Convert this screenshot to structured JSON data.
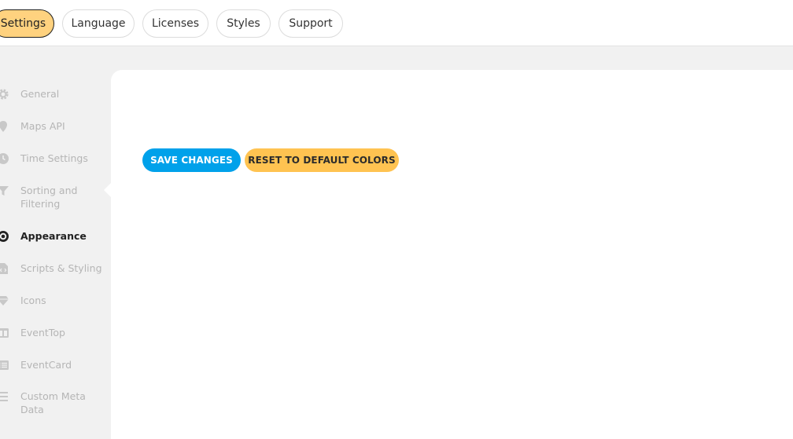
{
  "tabs": [
    {
      "label": "Settings",
      "active": true
    },
    {
      "label": "Language",
      "active": false
    },
    {
      "label": "Licenses",
      "active": false
    },
    {
      "label": "Styles",
      "active": false
    },
    {
      "label": "Support",
      "active": false
    }
  ],
  "sidebar": {
    "items": [
      {
        "label": "General",
        "icon": "gear-icon"
      },
      {
        "label": "Maps API",
        "icon": "map-pin-icon"
      },
      {
        "label": "Time Settings",
        "icon": "clock-icon"
      },
      {
        "label": "Sorting and Filtering",
        "icon": "filter-icon"
      },
      {
        "label": "Appearance",
        "icon": "eye-icon",
        "active": true
      },
      {
        "label": "Scripts & Styling",
        "icon": "file-code-icon"
      },
      {
        "label": "Icons",
        "icon": "gem-icon"
      },
      {
        "label": "EventTop",
        "icon": "columns-icon"
      },
      {
        "label": "EventCard",
        "icon": "list-card-icon"
      },
      {
        "label": "Custom Meta Data",
        "icon": "lines-icon"
      }
    ]
  },
  "actions": {
    "save_label": "SAVE CHANGES",
    "reset_label": "RESET TO DEFAULT COLORS"
  },
  "colors": {
    "accent_blue": "#00a1ea",
    "accent_yellow": "#ffc351",
    "active_tab": "#ffd27f"
  }
}
